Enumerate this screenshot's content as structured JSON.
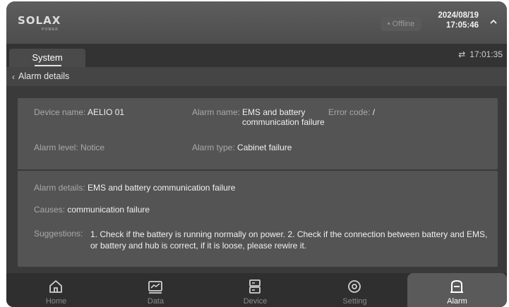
{
  "header": {
    "logo": "SOLAX",
    "logo_sub": "POWER",
    "status": "• Offline",
    "date": "2024/08/19",
    "time": "17:05:46"
  },
  "tabs": [
    {
      "label": "System"
    }
  ],
  "sync": {
    "time": "17:01:35"
  },
  "breadcrumb": {
    "label": "Alarm details"
  },
  "alarm": {
    "device_name_label": "Device name:",
    "device_name_value": "AELIO 01",
    "alarm_name_label": "Alarm name:",
    "alarm_name_value": "EMS and battery communication failure",
    "error_code_label": "Error code:",
    "error_code_value": "/",
    "alarm_level_label": "Alarm level:",
    "alarm_level_value": "Notice",
    "alarm_type_label": "Alarm type:",
    "alarm_type_value": "Cabinet failure",
    "details_label": "Alarm details:",
    "details_value": "EMS and battery communication failure",
    "causes_label": "Causes:",
    "causes_value": "communication failure",
    "suggestions_label": "Suggestions:",
    "suggestions_value": "1. Check if the battery is running normally on power. 2. Check if the connection between battery and EMS, or battery and hub is correct, if it is loose, please rewire it."
  },
  "nav": [
    {
      "label": "Home",
      "icon": "home-icon"
    },
    {
      "label": "Data",
      "icon": "chart-icon"
    },
    {
      "label": "Device",
      "icon": "device-icon"
    },
    {
      "label": "Setting",
      "icon": "gear-icon"
    },
    {
      "label": "Alarm",
      "icon": "alarm-icon",
      "active": true
    }
  ],
  "colors": {
    "accent": "#5a5a5a",
    "background": "#3a3a3a"
  }
}
